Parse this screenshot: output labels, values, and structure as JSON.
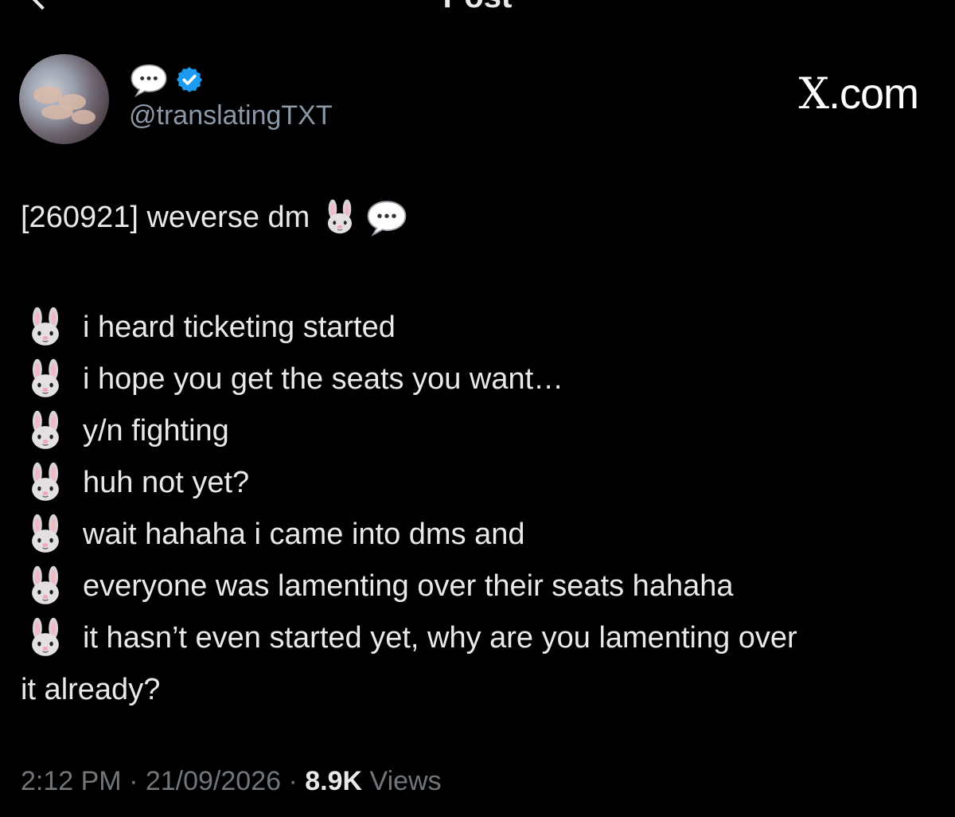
{
  "header": {
    "title": "Post"
  },
  "account": {
    "handle": "@translatingTXT",
    "display_name_icons": [
      "speech-bubble-icon",
      "verified-badge-icon"
    ]
  },
  "watermark": {
    "x": "X",
    "domain": ".com"
  },
  "tweet": {
    "headline": "[260921] weverse dm",
    "headline_emojis": [
      "rabbit-face-icon",
      "speech-bubble-icon"
    ],
    "lines": [
      "i heard ticketing started",
      "i hope you get the seats you want…",
      "y/n fighting",
      "huh not yet?",
      "wait hahaha i came into dms and",
      "everyone was lamenting over their seats hahaha",
      "it hasn’t even started yet, why are you lamenting over"
    ],
    "last_line_wrap": "it already?"
  },
  "meta": {
    "time": "2:12 PM",
    "separator": " · ",
    "date": "21/09/2026",
    "views_count": "8.9K",
    "views_label": " Views"
  },
  "colors": {
    "background": "#000000",
    "text": "#e7e9ea",
    "secondary": "#71767b",
    "handle": "#8b98a5",
    "verified": "#1d9bf0"
  }
}
